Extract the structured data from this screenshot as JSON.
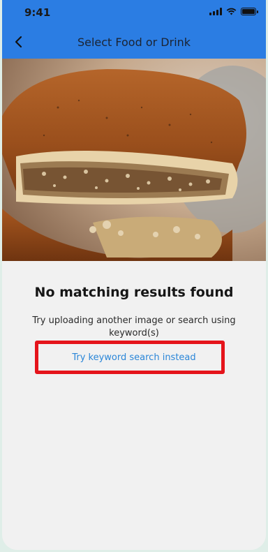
{
  "status_bar": {
    "time": "9:41"
  },
  "header": {
    "title": "Select Food or Drink"
  },
  "main": {
    "heading": "No matching results found",
    "message": "Try uploading another image or search using keyword(s)",
    "keyword_search_link": "Try keyword search instead"
  },
  "colors": {
    "header_bg": "#2b7de3",
    "link": "#2a86d8",
    "highlight": "#e5141b"
  }
}
